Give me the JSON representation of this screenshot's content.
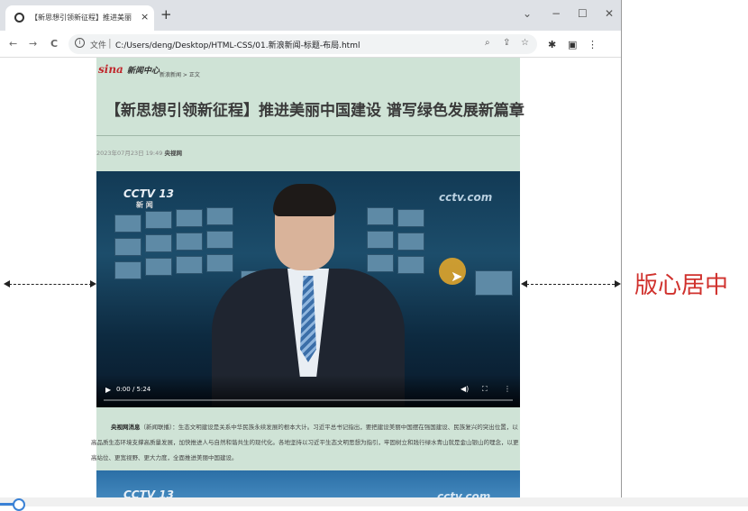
{
  "browser": {
    "tab_title": "【新思想引领新征程】推进美丽中",
    "tab_close": "×",
    "new_tab": "+",
    "window_controls": {
      "dropdown": "⌄",
      "minimize": "−",
      "maximize": "☐",
      "close": "✕"
    },
    "nav": {
      "back": "←",
      "forward": "→",
      "reload": "C"
    },
    "address": {
      "info": "i",
      "scheme": "文件",
      "separator": "|",
      "url": "C:/Users/deng/Desktop/HTML-CSS/01.新浪新闻-标题-布局.html",
      "zoom_icon": "⌕",
      "share_icon": "⇪",
      "star_icon": "☆"
    },
    "toolbar": {
      "extensions_icon": "✱",
      "sidebar_icon": "▣",
      "menu_icon": "⋮"
    }
  },
  "page": {
    "logo_main": "sina",
    "logo_sub": "新闻中心",
    "breadcrumb": "新浪新闻 > 正文",
    "headline": "【新思想引领新征程】推进美丽中国建设 谱写绿色发展新篇章",
    "date": "2023年07月23日 19:49",
    "source": "央视网",
    "video": {
      "channel_logo": "CCTV 13",
      "channel_name": "新 闻",
      "watermark": "cctv.com",
      "play_icon": "▶",
      "time": "0:00 / 5:24",
      "volume_icon": "◀)",
      "fullscreen_icon": "⛶",
      "more_icon": "⋮",
      "progress": 0.0
    },
    "body_lead": "央视网消息",
    "body_text": "（新闻联播）：生态文明建设是关系中华民族永续发展的根本大计。习近平总书记指出，要把建设美丽中国摆在强国建设、民族复兴的突出位置，以高品质生态环境支撑高质量发展，加快推进人与自然和谐共生的现代化。各地坚持以习近平生态文明思想为指引，牢固树立和践行绿水青山就是金山银山的理念，以更高站位、更宽视野、更大力度，全面推进美丽中国建设。",
    "video2": {
      "channel_logo": "CCTV 13",
      "watermark": "cctv.com"
    }
  },
  "annotation": {
    "label": "版心居中",
    "color": "#d0312d"
  },
  "colors": {
    "page_bg": "#cfe3d6",
    "tab_strip": "#dee1e6"
  }
}
